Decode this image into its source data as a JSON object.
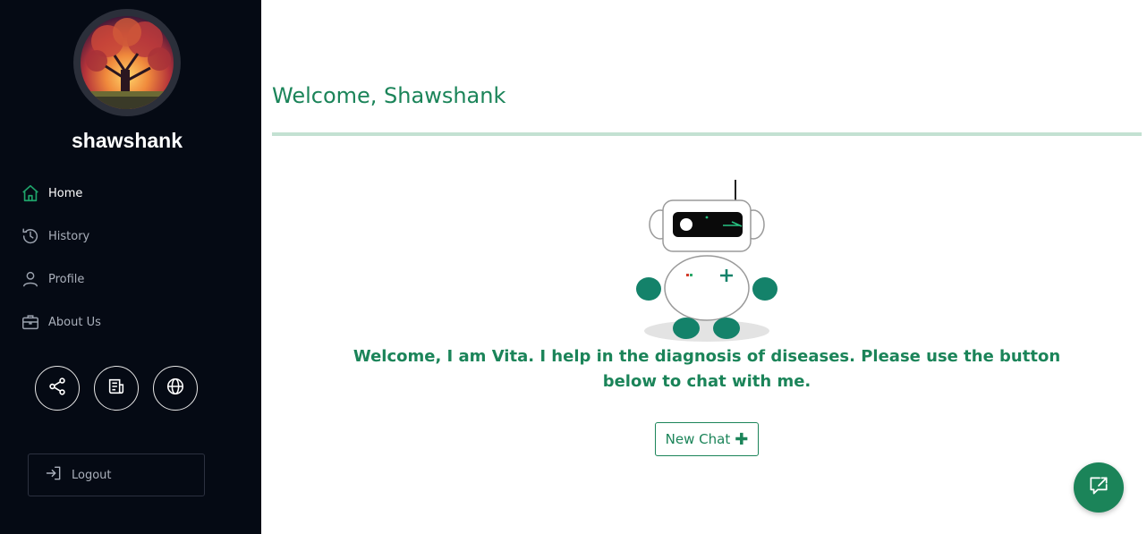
{
  "user": {
    "name": "shawshank"
  },
  "sidebar": {
    "items": [
      {
        "label": "Home",
        "icon": "home-icon",
        "active": true
      },
      {
        "label": "History",
        "icon": "history-icon",
        "active": false
      },
      {
        "label": "Profile",
        "icon": "person-icon",
        "active": false
      },
      {
        "label": "About Us",
        "icon": "briefcase-icon",
        "active": false
      }
    ],
    "quick_actions": [
      {
        "icon": "share-icon"
      },
      {
        "icon": "newspaper-icon"
      },
      {
        "icon": "globe-icon"
      }
    ],
    "logout_label": "Logout"
  },
  "main": {
    "welcome": "Welcome, Shawshank",
    "intro": "Welcome, I am Vita. I help in the diagnosis of diseases. Please use the button below to chat with me.",
    "new_chat_label": "New Chat",
    "new_chat_icon": "plus-icon"
  },
  "colors": {
    "accent": "#1b8459",
    "sidebar_bg": "#050a14",
    "rule": "#c3e1d2"
  }
}
